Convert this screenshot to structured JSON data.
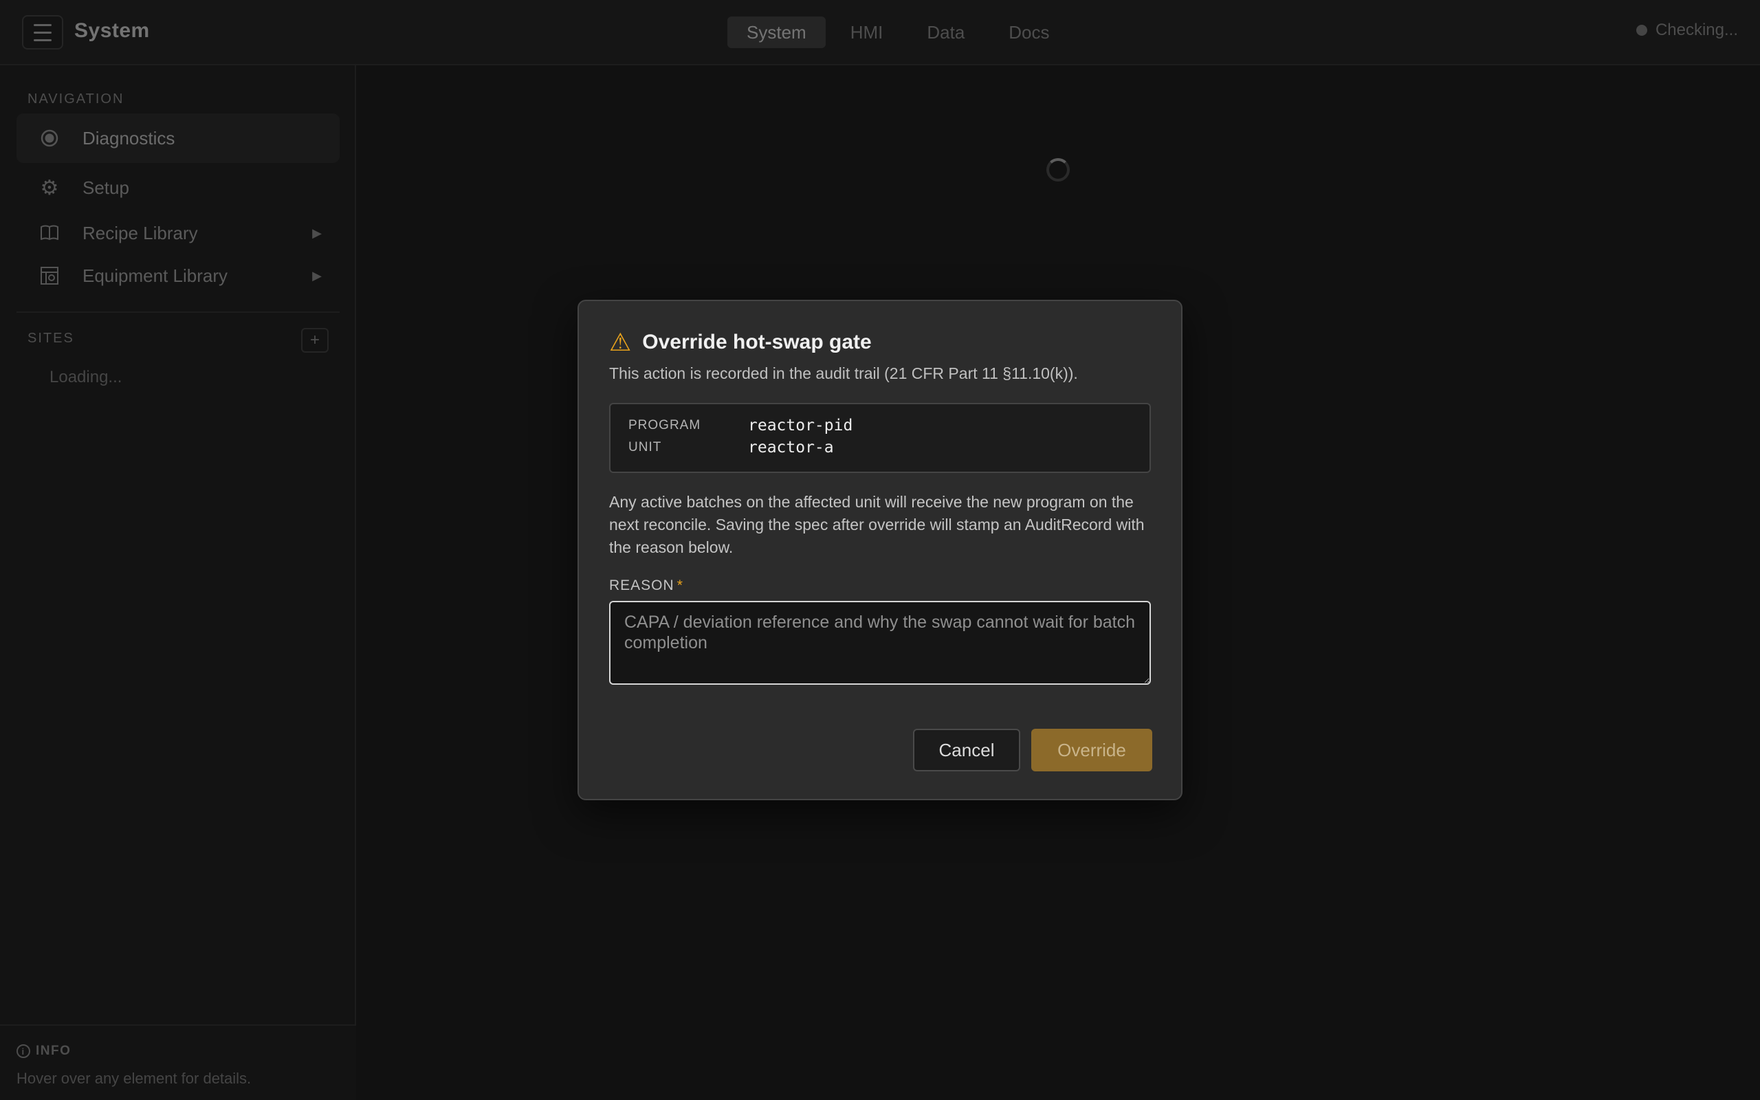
{
  "header": {
    "title": "System",
    "tabs": [
      {
        "label": "System",
        "active": true
      },
      {
        "label": "HMI",
        "active": false
      },
      {
        "label": "Data",
        "active": false
      },
      {
        "label": "Docs",
        "active": false
      }
    ],
    "status": "Checking..."
  },
  "sidebar": {
    "navigation_label": "NAVIGATION",
    "items": [
      {
        "label": "Diagnostics",
        "icon": "diagnostics-icon",
        "active": true
      },
      {
        "label": "Setup",
        "icon": "gear-icon",
        "active": false
      },
      {
        "label": "Recipe Library",
        "icon": "book-icon",
        "active": false,
        "expandable": true
      },
      {
        "label": "Equipment Library",
        "icon": "equipment-icon",
        "active": false,
        "expandable": true
      }
    ],
    "sites_label": "SITES",
    "sites_loading": "Loading...",
    "info": {
      "title": "INFO",
      "text": "Hover over any element for details."
    }
  },
  "modal": {
    "title": "Override hot-swap gate",
    "subtitle": "This action is recorded in the audit trail (21 CFR Part 11 §11.10(k)).",
    "details": [
      {
        "key": "PROGRAM",
        "value": "reactor-pid"
      },
      {
        "key": "UNIT",
        "value": "reactor-a"
      }
    ],
    "description": "Any active batches on the affected unit will receive the new program on the next reconcile. Saving the spec after override will stamp an AuditRecord with the reason below.",
    "reason_label": "REASON",
    "reason_required_mark": "*",
    "reason_value": "",
    "reason_placeholder": "CAPA / deviation reference and why the swap cannot wait for batch completion",
    "cancel_label": "Cancel",
    "override_label": "Override"
  },
  "colors": {
    "accent_warning": "#e8a21c",
    "override_button": "#8c6a2a",
    "background": "#222222"
  }
}
